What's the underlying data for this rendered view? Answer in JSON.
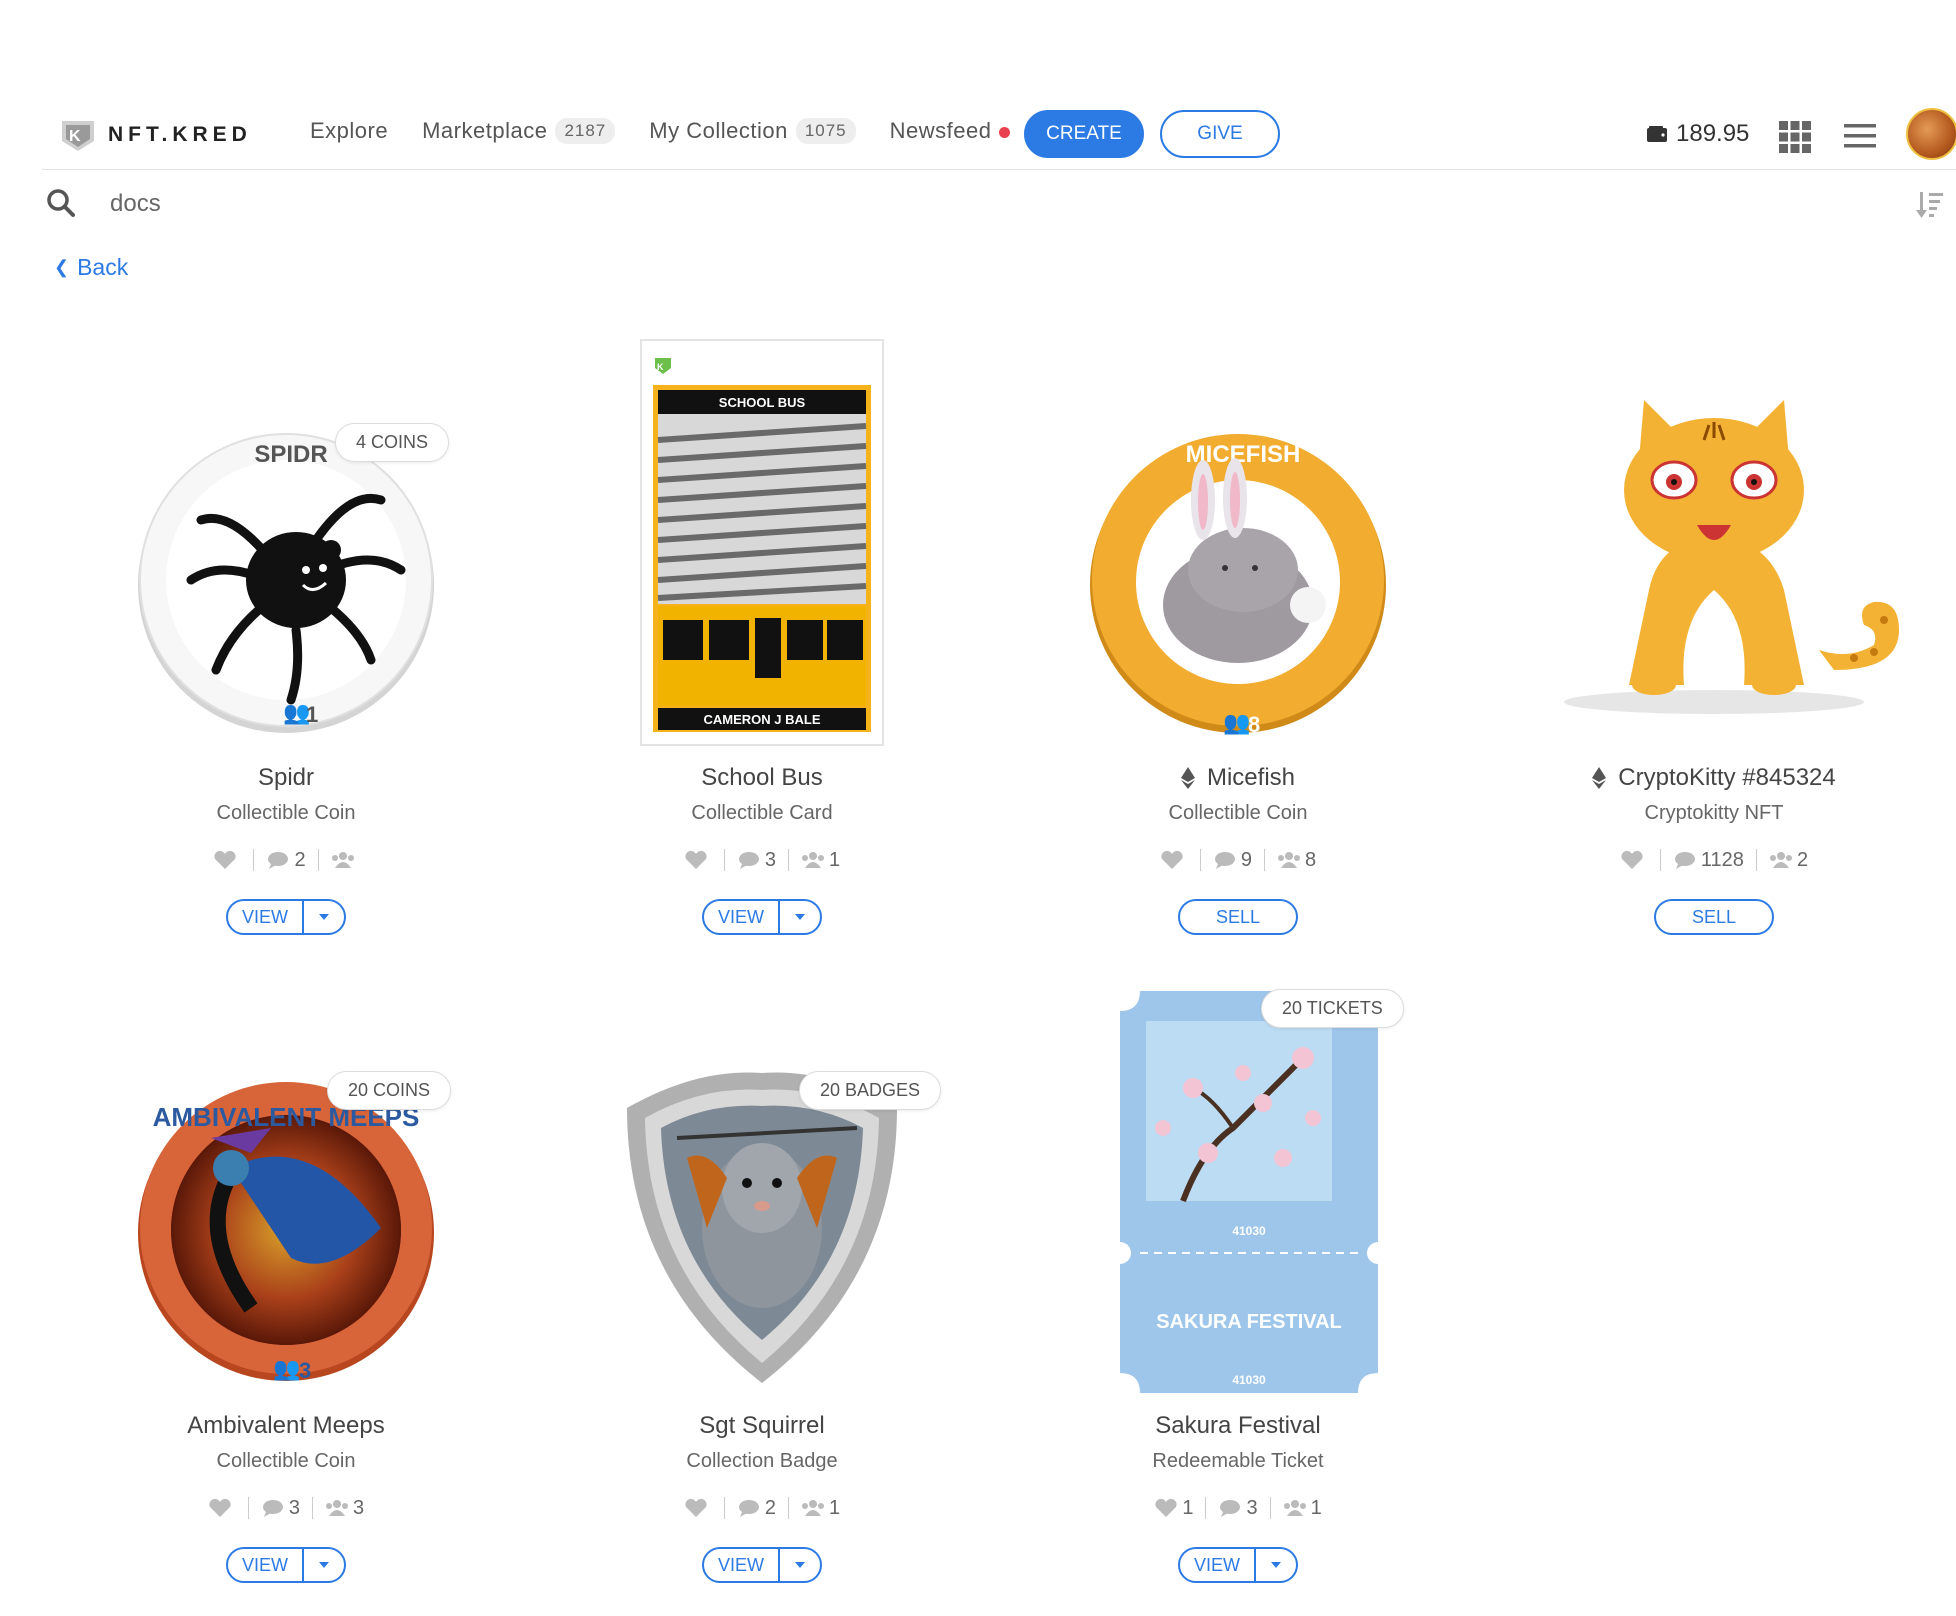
{
  "header": {
    "logo_text": "NFT.KRED",
    "nav": [
      {
        "label": "Explore"
      },
      {
        "label": "Marketplace",
        "count": "2187"
      },
      {
        "label": "My Collection",
        "count": "1075"
      },
      {
        "label": "Newsfeed"
      }
    ],
    "create_label": "CREATE",
    "give_label": "GIVE",
    "wallet_balance": "189.95",
    "icons": [
      "wallet-icon",
      "apps-grid-icon",
      "hamburger-menu-icon",
      "avatar"
    ]
  },
  "search": {
    "value": "docs",
    "placeholder": "Search"
  },
  "back_label": "Back",
  "colors": {
    "accent": "#2c7be5",
    "notification": "#e8404f"
  },
  "cards": [
    {
      "title": "Spidr",
      "subtitle": "Collectible Coin",
      "likes": "",
      "comments": "2",
      "owners": "",
      "action": "VIEW",
      "badge": "4 COINS",
      "coin_label": "SPIDR",
      "coin_count": "1"
    },
    {
      "title": "School Bus",
      "subtitle": "Collectible Card",
      "likes": "",
      "comments": "3",
      "owners": "1",
      "action": "VIEW",
      "badge": "",
      "card_top": "SCHOOL BUS",
      "card_bottom": "CAMERON J BALE"
    },
    {
      "title": "Micefish",
      "subtitle": "Collectible Coin",
      "likes": "",
      "comments": "9",
      "owners": "8",
      "action": "SELL",
      "badge": "",
      "eth": true,
      "coin_label": "MICEFISH",
      "coin_count": "8"
    },
    {
      "title": "CryptoKitty #845324",
      "subtitle": "Cryptokitty NFT",
      "likes": "",
      "comments": "1128",
      "owners": "2",
      "action": "SELL",
      "badge": "",
      "eth": true
    },
    {
      "title": "Ambivalent Meeps",
      "subtitle": "Collectible Coin",
      "likes": "",
      "comments": "3",
      "owners": "3",
      "action": "VIEW",
      "badge": "20 COINS",
      "coin_label": "AMBIVALENT MEEPS",
      "coin_count": "3"
    },
    {
      "title": "Sgt Squirrel",
      "subtitle": "Collection Badge",
      "likes": "",
      "comments": "2",
      "owners": "1",
      "action": "VIEW",
      "badge": "20 BADGES"
    },
    {
      "title": "Sakura Festival",
      "subtitle": "Redeemable Ticket",
      "likes": "1",
      "comments": "3",
      "owners": "1",
      "action": "VIEW",
      "badge": "20 TICKETS",
      "ticket_number": "41030",
      "ticket_title": "SAKURA FESTIVAL"
    }
  ]
}
